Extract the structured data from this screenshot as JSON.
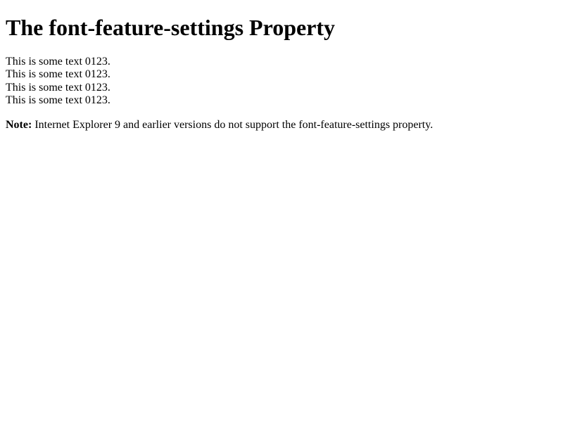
{
  "heading": "The font-feature-settings Property",
  "lines": {
    "0": "This is some text 0123.",
    "1": "This is some text 0123.",
    "2": "This is some text 0123.",
    "3": "This is some text 0123."
  },
  "note": {
    "label": "Note:",
    "text": " Internet Explorer 9 and earlier versions do not support the font-feature-settings property."
  }
}
